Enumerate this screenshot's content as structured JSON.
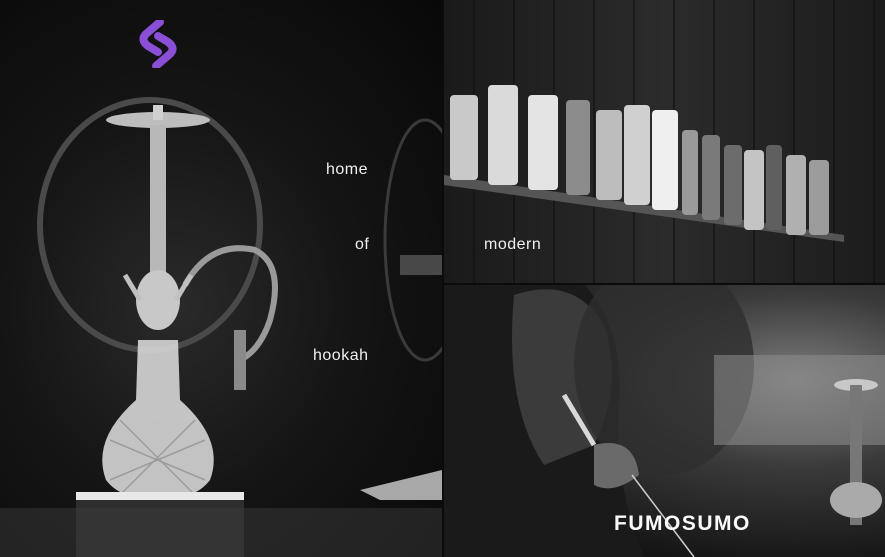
{
  "hero": {
    "words": {
      "home": "home",
      "of": "of",
      "modern": "modern",
      "hookah": "hookah"
    }
  },
  "brand": {
    "name": "FUMOSUMO",
    "accent": "#8a4fd6"
  },
  "icons": {
    "logo": "fumosumo-s-logo-icon"
  }
}
